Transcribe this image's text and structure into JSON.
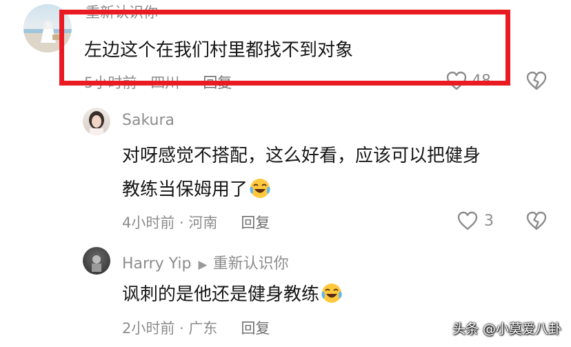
{
  "comments": [
    {
      "username": "重新认识你",
      "text": "左边这个在我们村里都找不到对象",
      "time": "5小时前 · 四川",
      "reply_label": "回复",
      "like_count": "48"
    },
    {
      "username": "Sakura",
      "text_line1": "对呀感觉不搭配，这么好看，应该可以把健身",
      "text_line2": "教练当保姆用了",
      "emoji": "laughing-crying-emoji",
      "time": "4小时前 · 河南",
      "reply_label": "回复",
      "like_count": "3"
    },
    {
      "username": "Harry Yip",
      "reply_to": "重新认识你",
      "text": "讽刺的是他还是健身教练",
      "emoji": "laughing-crying-emoji",
      "time": "2小时前 · 广东",
      "reply_label": "回复"
    }
  ],
  "watermark": "头条 @小莫爱八卦",
  "colors": {
    "highlight_border": "#ea1a22",
    "meta_text": "#8c8c8c",
    "body_text": "#161616"
  }
}
